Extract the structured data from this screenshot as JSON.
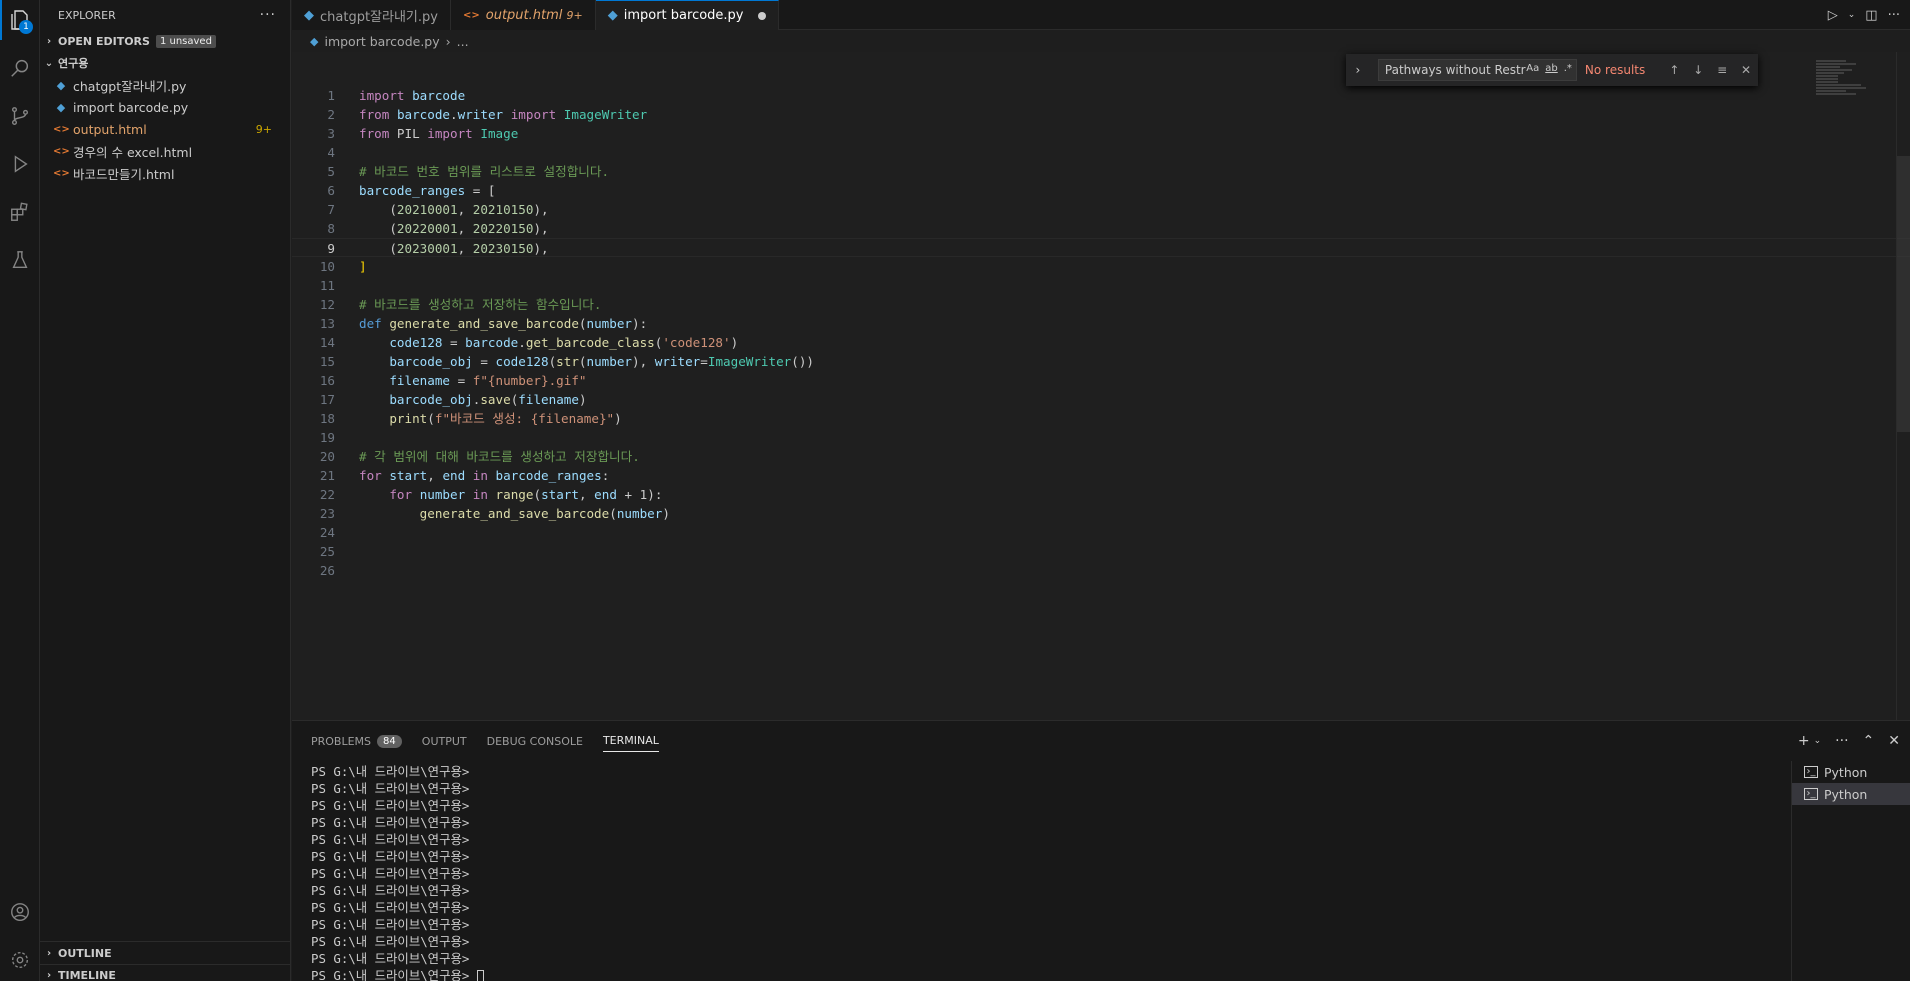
{
  "activity": {
    "explorer_badge": "1"
  },
  "explorer": {
    "title": "EXPLORER",
    "more": "···",
    "open_editors": "OPEN EDITORS",
    "unsaved": "1 unsaved",
    "folder": "연구용",
    "files": [
      {
        "name": "chatgpt잘라내기.py",
        "type": "py"
      },
      {
        "name": "import barcode.py",
        "type": "py"
      },
      {
        "name": "output.html",
        "type": "html",
        "count": "9+"
      },
      {
        "name": "경우의 수 excel.html",
        "type": "html"
      },
      {
        "name": "바코드만들기.html",
        "type": "html"
      }
    ],
    "outline": "OUTLINE",
    "timeline": "TIMELINE"
  },
  "tabs": [
    {
      "label": "chatgpt잘라내기.py",
      "icon": "python-icon"
    },
    {
      "label": "output.html",
      "suffix": "9+",
      "icon": "html-icon"
    },
    {
      "label": "import barcode.py",
      "icon": "python-icon",
      "active": true
    }
  ],
  "breadcrumb": {
    "file": "import barcode.py",
    "rest": "..."
  },
  "find": {
    "value": "Pathways without Restrict",
    "case": "Aa",
    "word": "ab",
    "regex": ".*",
    "status": "No results"
  },
  "code_lines": [
    "import barcode",
    "from barcode.writer import ImageWriter",
    "from PIL import Image",
    "",
    "# 바코드 번호 범위를 리스트로 설정합니다.",
    "barcode_ranges = [",
    "    (20210001, 20210150),",
    "    (20220001, 20220150),",
    "    (20230001, 20230150),",
    "]",
    "",
    "# 바코드를 생성하고 저장하는 함수입니다.",
    "def generate_and_save_barcode(number):",
    "    code128 = barcode.get_barcode_class('code128')",
    "    barcode_obj = code128(str(number), writer=ImageWriter())",
    "    filename = f\"{number}.gif\"",
    "    barcode_obj.save(filename)",
    "    print(f\"바코드 생성: {filename}\")",
    "",
    "# 각 범위에 대해 바코드를 생성하고 저장합니다.",
    "for start, end in barcode_ranges:",
    "    for number in range(start, end + 1):",
    "        generate_and_save_barcode(number)",
    "",
    "",
    ""
  ],
  "line_numbers": [
    "1",
    "2",
    "3",
    "4",
    "5",
    "6",
    "7",
    "8",
    "9",
    "10",
    "11",
    "12",
    "13",
    "14",
    "15",
    "16",
    "17",
    "18",
    "19",
    "20",
    "21",
    "22",
    "23",
    "24",
    "25",
    "26"
  ],
  "current_line": 9,
  "panel": {
    "tabs": [
      {
        "label": "PROBLEMS",
        "badge": "84"
      },
      {
        "label": "OUTPUT"
      },
      {
        "label": "DEBUG CONSOLE"
      },
      {
        "label": "TERMINAL",
        "active": true
      }
    ],
    "prompt": "PS G:\\내 드라이브\\연구용>",
    "prompt_count": 13,
    "terminals": [
      {
        "label": "Python"
      },
      {
        "label": "Python",
        "selected": true
      }
    ]
  },
  "colors": {
    "accent": "#0078d4",
    "bg": "#1f1f1f"
  }
}
